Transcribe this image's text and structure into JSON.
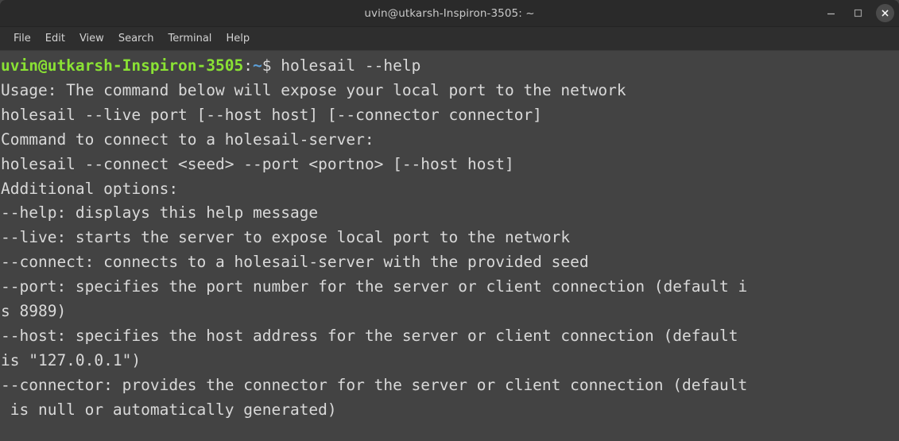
{
  "window": {
    "title": "uvin@utkarsh-Inspiron-3505: ~",
    "controls": {
      "minimize_label": "–",
      "maximize_label": "□",
      "close_label": "✕"
    }
  },
  "menubar": {
    "items": [
      {
        "label": "File"
      },
      {
        "label": "Edit"
      },
      {
        "label": "View"
      },
      {
        "label": "Search"
      },
      {
        "label": "Terminal"
      },
      {
        "label": "Help"
      }
    ]
  },
  "terminal": {
    "colors": {
      "background": "#434343",
      "foreground": "#d9d9d9",
      "prompt_user_host": "#8ae234",
      "prompt_path": "#5c9fd8",
      "titlebar_background": "#2a2a2a",
      "menubar_background": "#2e2e2e"
    },
    "prompt": {
      "user_host": "uvin@utkarsh-Inspiron-3505",
      "colon": ":",
      "path": "~",
      "sigil": "$",
      "command": " holesail --help"
    },
    "output_lines": [
      "Usage: The command below will expose your local port to the network",
      "holesail --live port [--host host] [--connector connector]",
      "Command to connect to a holesail-server:",
      "holesail --connect <seed> --port <portno> [--host host]",
      "Additional options:",
      "--help: displays this help message",
      "--live: starts the server to expose local port to the network",
      "--connect: connects to a holesail-server with the provided seed",
      "--port: specifies the port number for the server or client connection (default i",
      "s 8989)",
      "--host: specifies the host address for the server or client connection (default",
      "is \"127.0.0.1\")",
      "--connector: provides the connector for the server or client connection (default",
      " is null or automatically generated)"
    ]
  }
}
